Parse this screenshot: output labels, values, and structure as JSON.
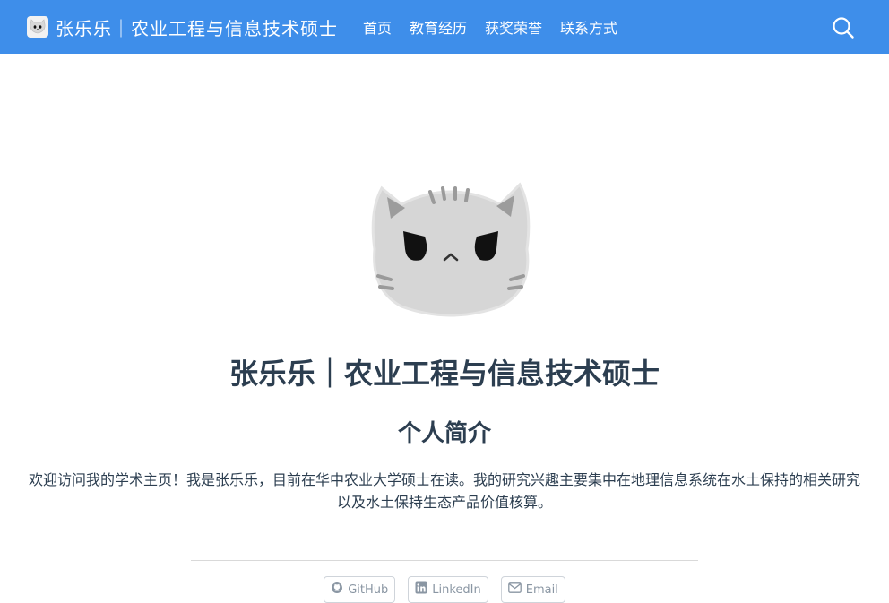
{
  "navbar": {
    "brand_title": "张乐乐｜农业工程与信息技术硕士",
    "links": [
      {
        "label": "首页"
      },
      {
        "label": "教育经历"
      },
      {
        "label": "获奖荣誉"
      },
      {
        "label": "联系方式"
      }
    ],
    "search_icon": "search-icon"
  },
  "hero": {
    "avatar_icon": "cat-avatar",
    "title": "张乐乐｜农业工程与信息技术硕士"
  },
  "intro": {
    "heading": "个人简介",
    "text": "欢迎访问我的学术主页！我是张乐乐，目前在华中农业大学硕士在读。我的研究兴趣主要集中在地理信息系统在水土保持的相关研究以及水土保持生态产品价值核算。"
  },
  "social": [
    {
      "label": "GitHub",
      "icon": "github-icon"
    },
    {
      "label": "LinkedIn",
      "icon": "linkedin-icon"
    },
    {
      "label": "Email",
      "icon": "email-icon"
    }
  ],
  "colors": {
    "navbar": "#3e8eea",
    "text": "#2c3e50",
    "muted": "#8a96a3"
  }
}
